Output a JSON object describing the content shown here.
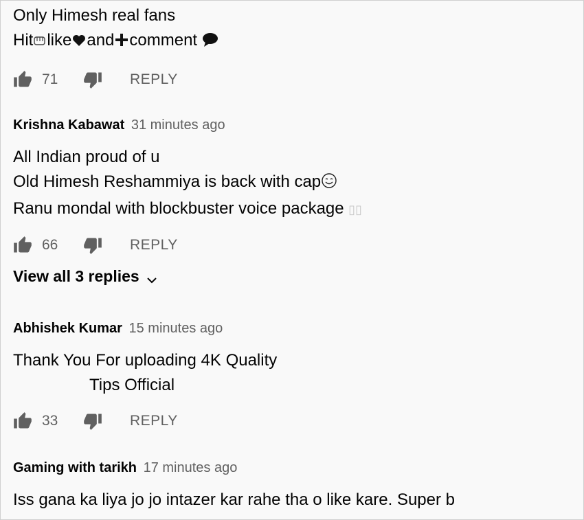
{
  "comments": [
    {
      "author": "",
      "time": "",
      "lines": [
        "Only Himesh real fans",
        "Hit",
        "like",
        "and",
        "comment"
      ],
      "likes": "71",
      "reply_label": "REPLY"
    },
    {
      "author": "Krishna Kabawat",
      "time": "31 minutes ago",
      "lines": [
        "All Indian proud of u",
        "Old Himesh Reshammiya is back with cap",
        "Ranu mondal with blockbuster voice package"
      ],
      "likes": "66",
      "reply_label": "REPLY",
      "view_replies": "View all 3 replies"
    },
    {
      "author": "Abhishek Kumar",
      "time": "15 minutes ago",
      "lines": [
        "Thank You For uploading 4K Quality",
        "Tips Official"
      ],
      "likes": "33",
      "reply_label": "REPLY"
    },
    {
      "author": "Gaming with tarikh",
      "time": "17 minutes ago",
      "lines": [
        "Iss gana ka liya jo jo intazer kar rahe tha o like kare. Super b"
      ]
    }
  ],
  "icons": {
    "like": "thumb-up-icon",
    "dislike": "thumb-down-icon",
    "expand": "chevron-down-icon",
    "fist": "fist-icon",
    "heart": "heart-icon",
    "plus": "plus-icon",
    "speech": "speech-bubble-icon",
    "smile": "smiling-face-icon"
  },
  "colors": {
    "background": "#f9f9f9",
    "text": "#030303",
    "secondary": "#606060"
  }
}
